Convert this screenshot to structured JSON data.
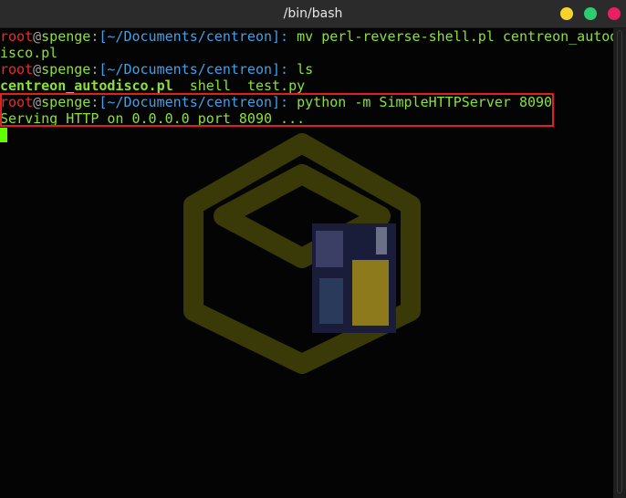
{
  "window": {
    "title": "/bin/bash",
    "buttons": [
      {
        "name": "minimize",
        "color": "#f8d32d"
      },
      {
        "name": "maximize",
        "color": "#2ecc71"
      },
      {
        "name": "close",
        "color": "#e91e63"
      }
    ]
  },
  "terminal": {
    "lines": [
      {
        "type": "prompt",
        "user": "root",
        "at": "@",
        "host": "spenge",
        "sep": ":",
        "path": "[~/Documents/centreon]:",
        "command": " mv perl-reverse-shell.pl centreon_autod",
        "wrap": "isco.pl"
      },
      {
        "type": "prompt",
        "user": "root",
        "at": "@",
        "host": "spenge",
        "sep": ":",
        "path": "[~/Documents/centreon]:",
        "command": " ls"
      },
      {
        "type": "listing",
        "items": [
          "centreon_autodisco.pl",
          "shell",
          "test.py"
        ]
      },
      {
        "type": "prompt",
        "user": "root",
        "at": "@",
        "host": "spenge",
        "sep": ":",
        "path": "[~/Documents/centreon]:",
        "command": " python -m SimpleHTTPServer 8090"
      },
      {
        "type": "output",
        "text": "Serving HTTP on 0.0.0.0 port 8090 ..."
      }
    ]
  },
  "colors": {
    "background": "#040404",
    "user": "#ef2929",
    "host": "#8ae234",
    "path": "#3fa1e8",
    "text": "#8ae234",
    "highlight": "#e02020",
    "logo": "#3a3a08"
  },
  "icons": {
    "background_logo": "cube-logo-icon"
  }
}
